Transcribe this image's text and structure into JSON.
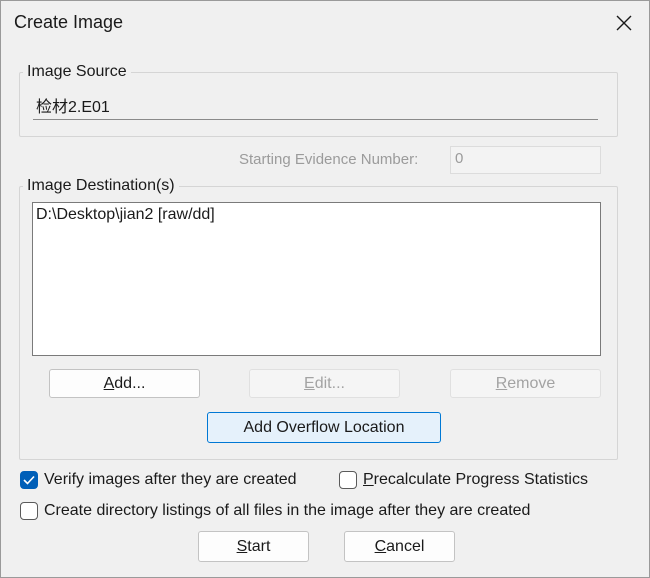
{
  "window": {
    "title": "Create Image"
  },
  "source": {
    "group_label": "Image Source",
    "value": "检材2.E01"
  },
  "evidence": {
    "label": "Starting Evidence Number:",
    "value": "0"
  },
  "destination": {
    "group_label": "Image Destination(s)",
    "items": [
      "D:\\Desktop\\jian2 [raw/dd]"
    ],
    "add_label_underline": "A",
    "add_label_rest": "dd...",
    "edit_label_underline": "E",
    "edit_label_rest": "dit...",
    "remove_label_underline": "R",
    "remove_label_rest": "emove",
    "overflow_label": "Add Overflow Location"
  },
  "options": {
    "verify_label": "Verify images after they are created",
    "verify_checked": true,
    "precalc_label_underline": "P",
    "precalc_label_rest": "recalculate Progress Statistics",
    "precalc_checked": false,
    "dirlist_label": "Create directory listings of all files in the image after they are created",
    "dirlist_checked": false
  },
  "footer": {
    "start_underline": "S",
    "start_rest": "tart",
    "cancel_underline": "C",
    "cancel_rest": "ancel"
  },
  "colors": {
    "accent": "#005fb8",
    "primary_border": "#0078d4"
  }
}
